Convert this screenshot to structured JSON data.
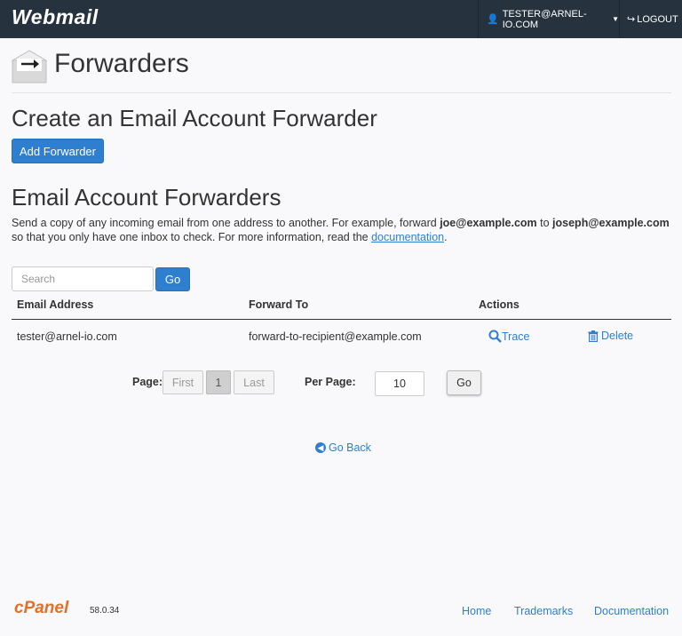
{
  "header": {
    "brand": "Webmail",
    "user_label": "TESTER@ARNEL-IO.COM",
    "logout_label": "LOGOUT"
  },
  "page": {
    "title": "Forwarders"
  },
  "create_section": {
    "heading": "Create an Email Account Forwarder",
    "add_button": "Add Forwarder"
  },
  "list_section": {
    "heading": "Email Account Forwarders",
    "desc_part1": "Send a copy of any incoming email from one address to another. For example, forward ",
    "desc_bold1": "joe@example.com",
    "desc_part2": " to ",
    "desc_bold2": "joseph@example.com",
    "desc_part3": " so that you only have one inbox to check. For more information, read the ",
    "desc_link": "documentation",
    "desc_end": "."
  },
  "search": {
    "placeholder": "Search",
    "go_label": "Go"
  },
  "table": {
    "headers": {
      "email": "Email Address",
      "forward": "Forward To",
      "actions": "Actions"
    },
    "rows": [
      {
        "email": "tester@arnel-io.com",
        "forward": "forward-to-recipient@example.com",
        "trace": "Trace",
        "delete": "Delete"
      }
    ]
  },
  "pagination": {
    "page_label": "Page:",
    "first": "First",
    "current": "1",
    "last": "Last",
    "per_page_label": "Per Page:",
    "per_page_value": "10",
    "go_label": "Go"
  },
  "go_back": "Go Back",
  "footer": {
    "logo": "cPanel",
    "version": "58.0.34",
    "links": {
      "home": "Home",
      "trademarks": "Trademarks",
      "documentation": "Documentation"
    }
  },
  "colors": {
    "topbar": "#26333f",
    "primary": "#2f7fd0",
    "link": "#2f7fd0",
    "cpanel_orange": "#e3702a"
  }
}
